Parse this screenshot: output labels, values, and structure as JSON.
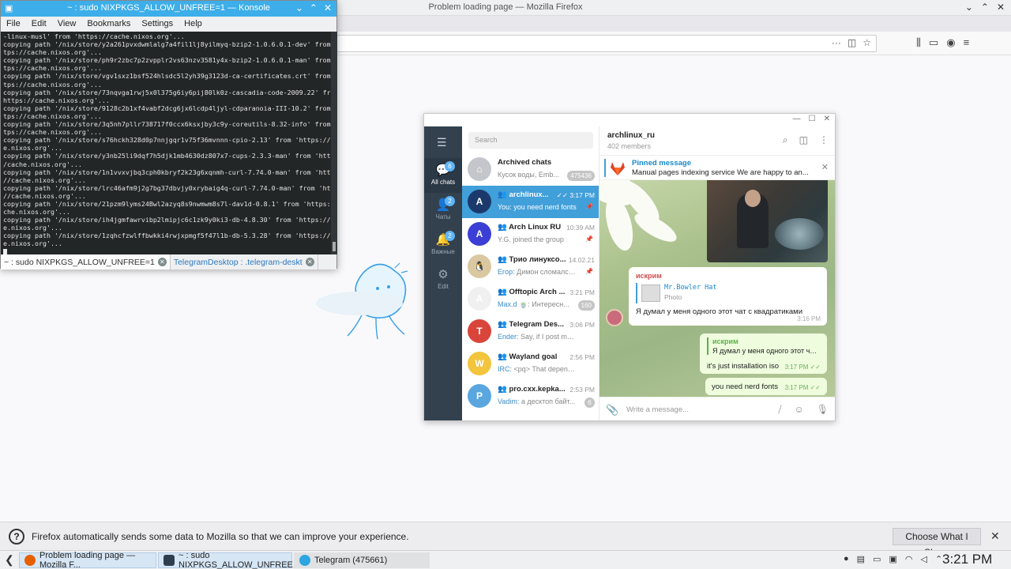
{
  "firefox": {
    "title": "Problem loading page — Mozilla Firefox",
    "notification": {
      "text": "Firefox automatically sends some data to Mozilla so that we can improve your experience.",
      "button": "Choose What I Share"
    }
  },
  "konsole": {
    "title": "~ : sudo NIXPKGS_ALLOW_UNFREE=1 — Konsole",
    "menu": [
      "File",
      "Edit",
      "View",
      "Bookmarks",
      "Settings",
      "Help"
    ],
    "lines": [
      "-linux-musl' from 'https://cache.nixos.org'...",
      "copying path '/nix/store/y2a261pvxdwmlalg7a4fil1lj8yilmyq-bzip2-1.0.6.0.1-dev' from 'ht",
      "tps://cache.nixos.org'...",
      "copying path '/nix/store/ph9r2zbc7p2zvpplr2vs63nzv3581y4x-bzip2-1.0.6.0.1-man' from 'ht",
      "tps://cache.nixos.org'...",
      "copying path '/nix/store/vgv1sxz1bsf524hlsdc5l2yh39g3123d-ca-certificates.crt' from 'ht",
      "tps://cache.nixos.org'...",
      "copying path '/nix/store/73nqvga1rwj5x0l375g6iy6pij80lk0z-cascadia-code-2009.22' from '",
      "https://cache.nixos.org'...",
      "copying path '/nix/store/9128c2b1xf4vabf2dcg6jx6lcdp4ljyl-cdparanoia-III-10.2' from 'ht",
      "tps://cache.nixos.org'...",
      "copying path '/nix/store/3q5nh7pllr738717f0ccx6ksxjby3c9y-coreutils-8.32-info' from 'ht",
      "tps://cache.nixos.org'...",
      "copying path '/nix/store/s76hckh328d0p7nnjgqr1v75f36mvnnn-cpio-2.13' from 'https://cach",
      "e.nixos.org'...",
      "copying path '/nix/store/y3nb25li9dqf7h5djk1mb4630dz807x7-cups-2.3.3-man' from 'https:/",
      "/cache.nixos.org'...",
      "copying path '/nix/store/1n1vvxvjbq3cph0kbryf2k23g6xqnmh-curl-7.74.0-man' from 'https:",
      "//cache.nixos.org'...",
      "copying path '/nix/store/lrc46afm9j2g7bg37dbvjy0xrybaig4q-curl-7.74.0-man' from 'https:",
      "//cache.nixos.org'...",
      "copying path '/nix/store/21pzm9lyms24Bwl2azyq8s9nwmwm8s7l-dav1d-0.8.1' from 'https://ca",
      "che.nixos.org'...",
      "copying path '/nix/store/ih4jgmfawrvibp2lmipjc6c1zk9y0ki3-db-4.8.30' from 'https://cach",
      "e.nixos.org'...",
      "copying path '/nix/store/1zqhcfzwlffbwkki4rwjxpmgf5f47l1b-db-5.3.28' from 'https://cach",
      "e.nixos.org'..."
    ],
    "tabs": [
      "~ : sudo NIXPKGS_ALLOW_UNFREE=1",
      "TelegramDesktop : .telegram-deskt"
    ]
  },
  "telegram": {
    "search_placeholder": "Search",
    "sidebar": [
      {
        "label": "All chats",
        "badge": "6"
      },
      {
        "label": "Чаты",
        "badge": "2"
      },
      {
        "label": "Важные",
        "badge": "2"
      },
      {
        "label": "Edit",
        "badge": ""
      }
    ],
    "chats": [
      {
        "name": "Archived chats",
        "time": "",
        "sender": "",
        "msg": "Кусок воды, Emb...",
        "badge": "475436",
        "color": "#c3c7cc",
        "initial": "⌂"
      },
      {
        "name": "👥  archlinux...",
        "time": "✓✓ 3:17 PM",
        "sender": "You:",
        "msg": "you need nerd fonts",
        "badge": "",
        "pin": "📌",
        "color": "#1b3a6b",
        "initial": "A"
      },
      {
        "name": "👥 Arch Linux RU",
        "time": "10:39 AM",
        "sender": "",
        "msg": "Y.G. joined the group",
        "badge": "",
        "pin": "📌",
        "color": "#3b3fd6",
        "initial": "A"
      },
      {
        "name": "👥 Трио линуксо...",
        "time": "14.02.21",
        "sender": "Егор:",
        "msg": "Димон сломался,...",
        "badge": "",
        "pin": "📌",
        "color": "#d9c8a0",
        "initial": "🐧"
      },
      {
        "name": "👥 Offtopic Arch ...",
        "time": "3:21 PM",
        "sender": "Max.d",
        "msg": "🍵: Интересн...",
        "badge": "160",
        "color": "#f0f0f0",
        "initial": "A"
      },
      {
        "name": "👥 Telegram Des...",
        "time": "3:06 PM",
        "sender": "Ender:",
        "msg": "Say, if I post my own ...",
        "badge": "",
        "color": "#d9453b",
        "initial": "T"
      },
      {
        "name": "👥 Wayland goal",
        "time": "2:56 PM",
        "sender": "IRC:",
        "msg": "<pq> That depends, th...",
        "badge": "",
        "color": "#f2c53d",
        "initial": "W"
      },
      {
        "name": "👥 pro.cxx.kepka...",
        "time": "2:53 PM",
        "sender": "Vadim:",
        "msg": "а десктоп байт...",
        "badge": "6",
        "color": "#5aa7e0",
        "initial": "P"
      }
    ],
    "chat": {
      "name": " archlinux_ru ",
      "members": "402 members",
      "pinned_title": "Pinned message",
      "pinned_text": "Manual pages indexing service  We are happy to an...",
      "msg1_sender": "искрим",
      "msg1_reply_name": "Mr.Bowler Hat",
      "msg1_reply_type": "Photo",
      "msg1_text": "Я думал у меня одного этот чат с квадратиками",
      "msg1_time": "3:16 PM",
      "msg2_quote_name": "искрим",
      "msg2_quote_text": "Я думал у меня одного этот ча...",
      "msg2_text": "it's just installation iso",
      "msg2_time": "3:17 PM",
      "msg3_text": "you need nerd fonts",
      "msg3_time": "3:17 PM",
      "input_placeholder": "Write a message..."
    }
  },
  "taskbar": {
    "tasks": [
      "Problem loading page — Mozilla F...",
      "~ : sudo NIXPKGS_ALLOW_UNFREE...",
      "Telegram (475661)"
    ],
    "clock": "3:21 PM"
  }
}
